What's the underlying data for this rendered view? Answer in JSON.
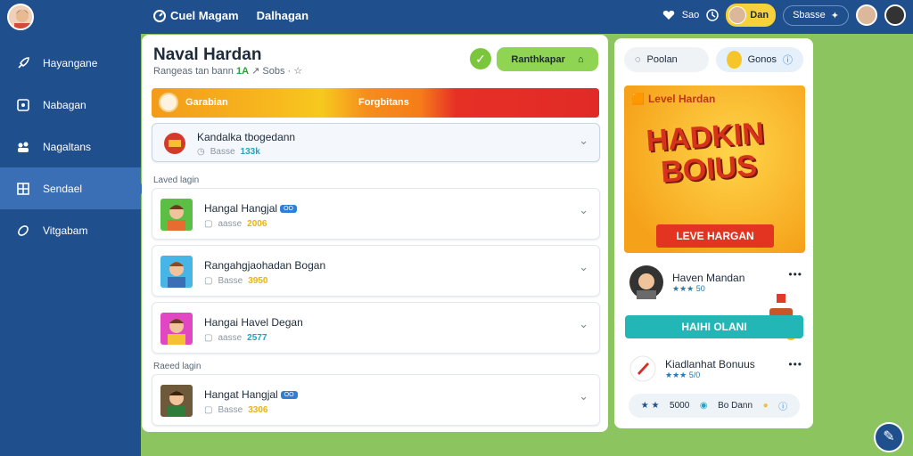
{
  "topbar": {
    "nav": [
      {
        "label": "Cuel Magam",
        "icon": "gauge-icon"
      },
      {
        "label": "Dalhagan"
      }
    ],
    "right": {
      "heart_label": "Sao",
      "coin_label": "Dan",
      "pill_label": "Sbasse"
    }
  },
  "sidebar": {
    "items": [
      {
        "label": "Hayangane",
        "icon": "rocket-icon"
      },
      {
        "label": "Nabagan",
        "icon": "puzzle-icon"
      },
      {
        "label": "Nagaltans",
        "icon": "team-icon"
      },
      {
        "label": "Sendael",
        "icon": "grid-icon",
        "active": true
      },
      {
        "label": "Vitgabam",
        "icon": "link-icon"
      }
    ]
  },
  "main": {
    "title": "Naval Hardan",
    "subtitle_prefix": "Rangeas tan bann",
    "subtitle_value": "1A",
    "subtitle_suffix": "Sobs",
    "action_label": "Ranthkapar",
    "banner": {
      "left": "Garabian",
      "center": "Forgbitans"
    },
    "featured": {
      "title": "Kandalka tbogedann",
      "meta_label": "Basse",
      "meta_value": "133k"
    },
    "section1": "Laved lagin",
    "section2": "Raeed lagin",
    "items": [
      {
        "title": "Hangal Hangjal",
        "tag": "OO",
        "meta_label": "aasse",
        "value": "2006",
        "value_color": "#e7b50d"
      },
      {
        "title": "Rangahgjaohadan Bogan",
        "meta_label": "Basse",
        "value": "3950",
        "value_color": "#e7b50d"
      },
      {
        "title": "Hangai Havel Degan",
        "meta_label": "aasse",
        "value": "2577",
        "value_color": "#22a3c5"
      },
      {
        "title": "Hangat Hangjal",
        "tag": "OO",
        "meta_label": "Basse",
        "value": "3306",
        "value_color": "#e7b50d"
      }
    ]
  },
  "right": {
    "pill1": "Poolan",
    "pill2": "Gonos",
    "promo": {
      "title": "Level Hardan",
      "big1": "HADKIN",
      "big2": "BOIUS",
      "button": "LEVE HARGAN"
    },
    "user1": {
      "name": "Haven Mandan",
      "rating": "★★★ 50"
    },
    "teal_button": "HAIHI OLANI",
    "user2": {
      "name": "Kiadlanhat Bonuus",
      "rating": "★★★ 5/0"
    },
    "bottom": {
      "stars": "★ ★",
      "value": "5000",
      "coin_label": "Bo Dann"
    }
  }
}
